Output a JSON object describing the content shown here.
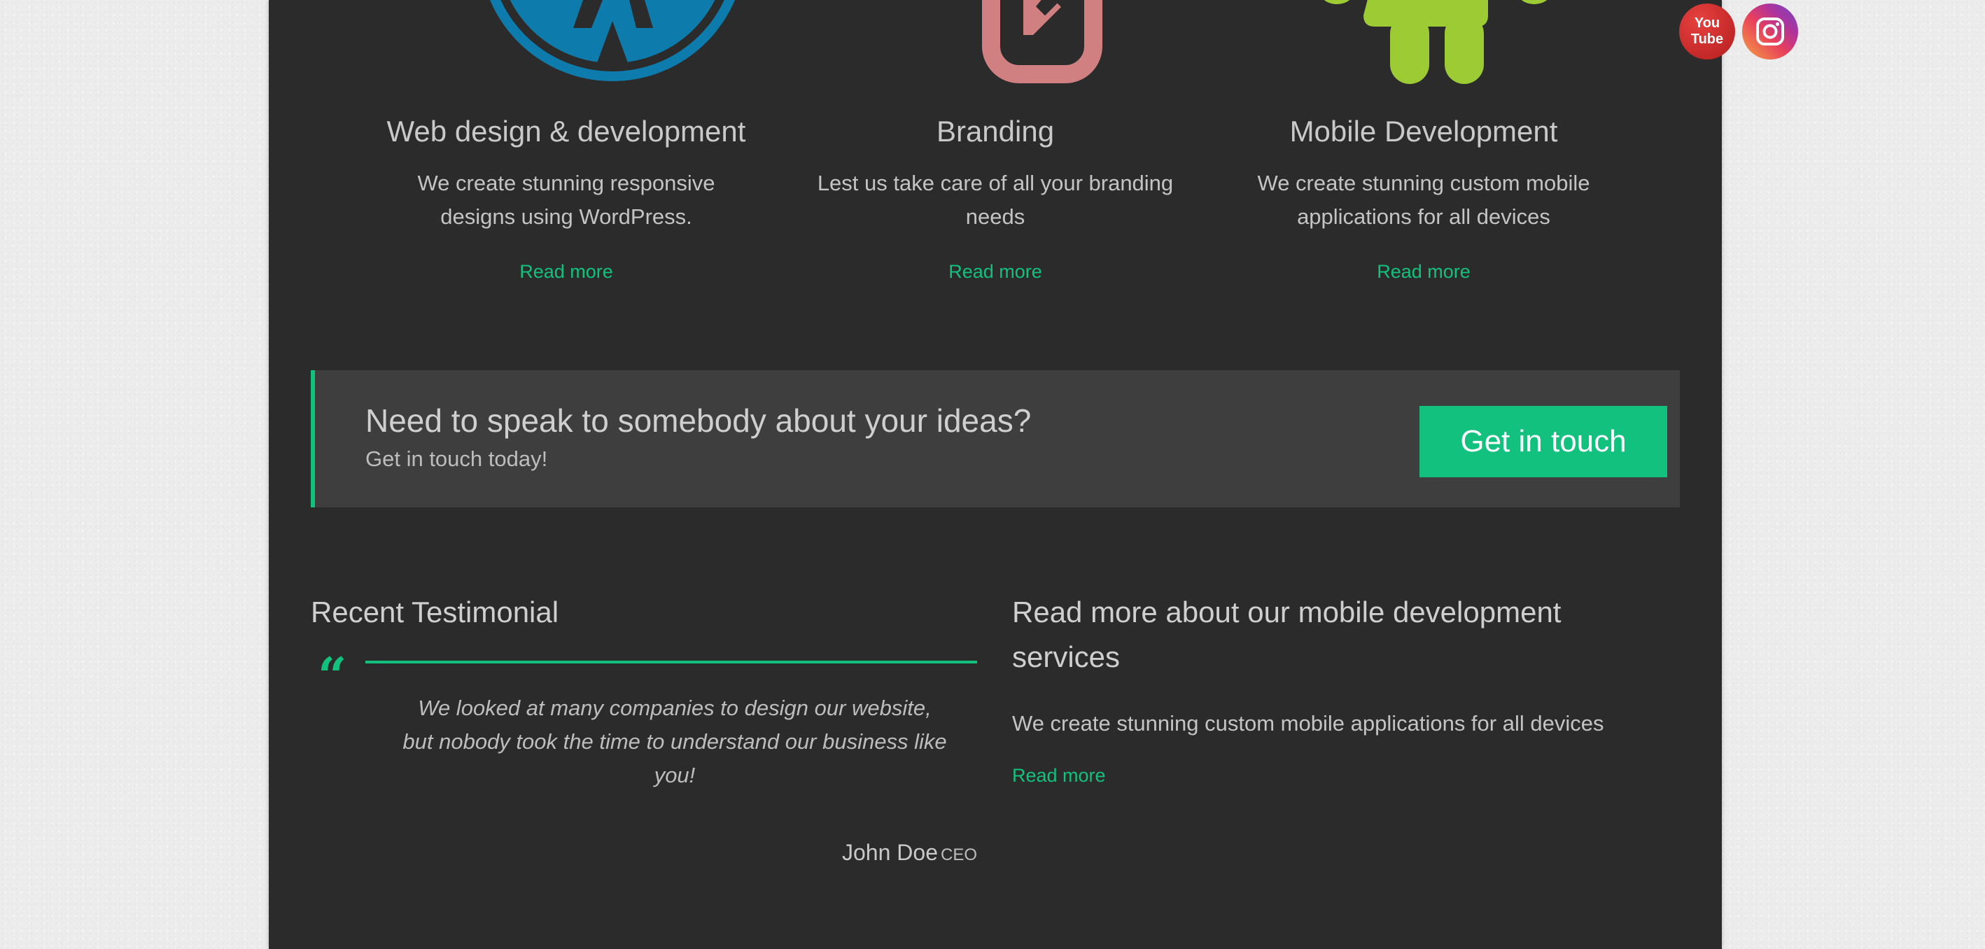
{
  "features": [
    {
      "icon": "wordpress-icon",
      "title": "Web design & development",
      "description": "We create stunning responsive designs using WordPress.",
      "link": "Read more"
    },
    {
      "icon": "edit-icon",
      "title": "Branding",
      "description": "Lest us take care of all your branding needs",
      "link": "Read more"
    },
    {
      "icon": "android-icon",
      "title": "Mobile Development",
      "description": "We create stunning custom mobile applications for all devices",
      "link": "Read more"
    }
  ],
  "cta": {
    "heading": "Need to speak to somebody about your ideas?",
    "subheading": "Get in touch today!",
    "button": "Get in touch"
  },
  "testimonial": {
    "section_title": "Recent Testimonial",
    "quote": "We looked at many companies to design our website, but nobody took the time to understand our business like you!",
    "author": "John Doe",
    "role": "CEO"
  },
  "mobile_section": {
    "title": "Read more about our mobile development services",
    "description": "We create stunning custom mobile applications for all devices",
    "link": "Read more"
  },
  "social": {
    "youtube_line1": "You",
    "youtube_line2": "Tube"
  },
  "colors": {
    "accent": "#12c17e",
    "page_bg": "#2b2b2b",
    "wordpress": "#0d7bab",
    "branding": "#d08080",
    "android": "#9ccb33"
  }
}
